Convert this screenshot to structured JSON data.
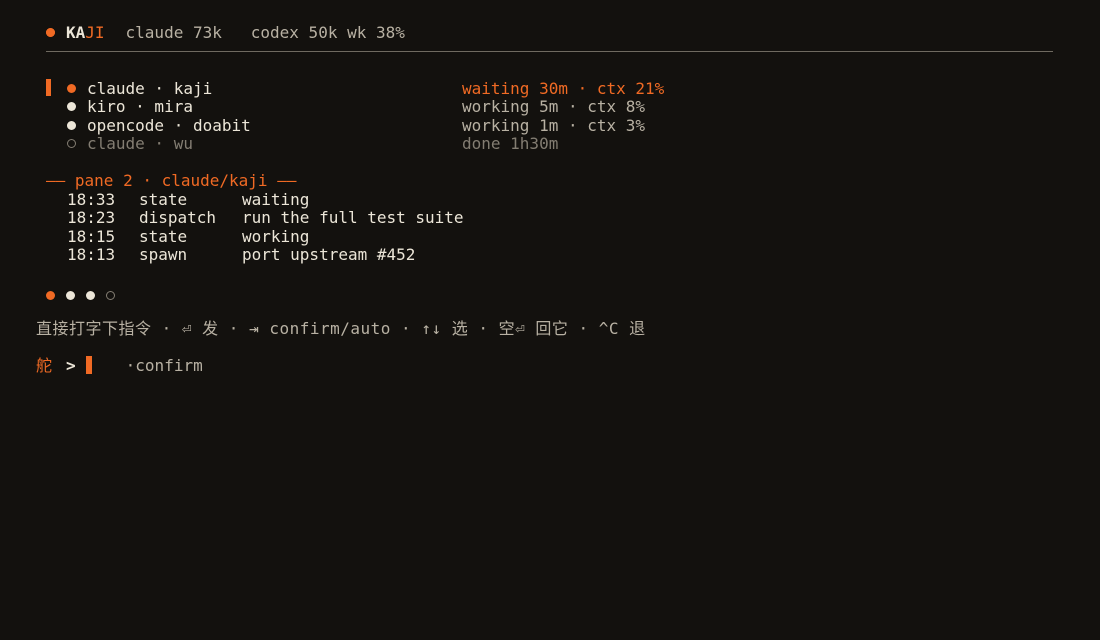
{
  "header": {
    "logo_icon": "orange-ring-dot-icon",
    "brand_a": "KA",
    "brand_b": "JI",
    "usage": "claude 73k   codex 50k wk 38%",
    "accent_color": "#f06a24"
  },
  "sessions": [
    {
      "name": "claude · kaji",
      "status": "waiting 30m · ctx 21%",
      "selected": true,
      "dot": "orange-dot-icon"
    },
    {
      "name": "kiro · mira",
      "status": "working 5m · ctx 8%",
      "selected": false,
      "dot": "white-dot-icon"
    },
    {
      "name": "opencode · doabit",
      "status": "working 1m · ctx 3%",
      "selected": false,
      "dot": "white-dot-icon"
    },
    {
      "name": "claude · wu",
      "status": "done 1h30m",
      "selected": false,
      "dot": "hollow-dot-icon"
    }
  ],
  "pane": {
    "title": "—— pane 2 · claude/kaji ——",
    "log": [
      {
        "time": "18:33",
        "kind": "state",
        "detail": "waiting"
      },
      {
        "time": "18:23",
        "kind": "dispatch",
        "detail": "run the full test suite"
      },
      {
        "time": "18:15",
        "kind": "state",
        "detail": "working"
      },
      {
        "time": "18:13",
        "kind": "spawn",
        "detail": "port upstream #452"
      }
    ]
  },
  "pager": [
    "orange-dot-icon",
    "white-dot-icon",
    "white-dot-icon",
    "hollow-dot-icon"
  ],
  "hint": "直接打字下指令 · ⏎ 发 · ⇥ confirm/auto · ↑↓ 选 · 空⏎ 回它 · ^C 退",
  "prompt": {
    "label": "舵",
    "caret": ">",
    "suggestion": "·confirm"
  }
}
